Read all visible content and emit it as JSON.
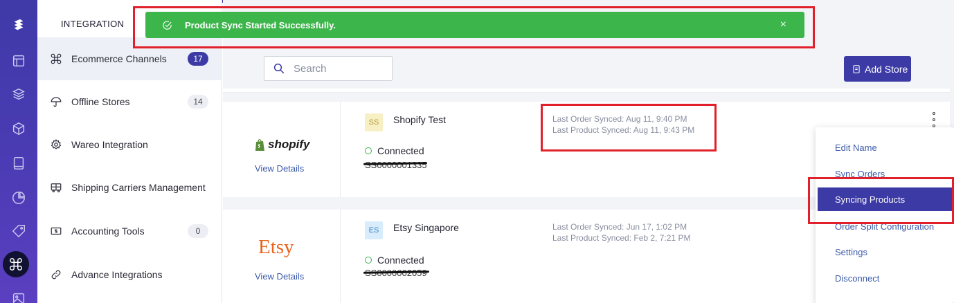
{
  "sidebar": {
    "title": "INTEGRATION",
    "items": [
      {
        "label": "Ecommerce Channels",
        "badge": "17",
        "icon": "command-icon",
        "active": true
      },
      {
        "label": "Offline Stores",
        "badge": "14",
        "icon": "umbrella-icon"
      },
      {
        "label": "Wareo Integration",
        "badge": "",
        "icon": "gear-icon"
      },
      {
        "label": "Shipping Carriers Management",
        "badge": "",
        "icon": "truck-icon"
      },
      {
        "label": "Accounting Tools",
        "badge": "0",
        "icon": "cash-icon"
      },
      {
        "label": "Advance Integrations",
        "badge": "",
        "icon": "link-icon"
      }
    ]
  },
  "rail": {
    "icons": [
      "logo-icon",
      "layout-icon",
      "layers-icon",
      "box-icon",
      "tablet-icon",
      "pie-chart-icon",
      "tag-icon",
      "command-icon",
      "image-icon"
    ],
    "active": "command-icon"
  },
  "toast": {
    "message": "Product Sync Started Successfully.",
    "close": "×",
    "color": "#3cb54a"
  },
  "search": {
    "placeholder": "Search"
  },
  "toolbar": {
    "add_store_label": "Add Store"
  },
  "stores": [
    {
      "logo": "shopify",
      "badge": "SS",
      "name": "Shopify Test",
      "status": "Connected",
      "id": "SS0000001335",
      "view_details": "View Details",
      "last_order": "Last Order Synced: Aug 11, 9:40 PM",
      "last_product": "Last Product Synced: Aug 11, 9:43 PM"
    },
    {
      "logo": "Etsy",
      "badge": "ES",
      "name": "Etsy Singapore",
      "status": "Connected",
      "id": "SS0000002059",
      "view_details": "View Details",
      "last_order": "Last Order Synced: Jun 17, 1:02 PM",
      "last_product": "Last Product Synced: Feb 2, 7:21 PM"
    }
  ],
  "menu": {
    "items": [
      "Edit Name",
      "Sync Orders",
      "Syncing Products",
      "Order Split Configuration",
      "Settings",
      "Disconnect"
    ],
    "active": "Syncing Products"
  },
  "colors": {
    "accent": "#3c3aa5",
    "success": "#3cb54a",
    "highlight": "#e0202a",
    "link": "#3c5aa8"
  }
}
